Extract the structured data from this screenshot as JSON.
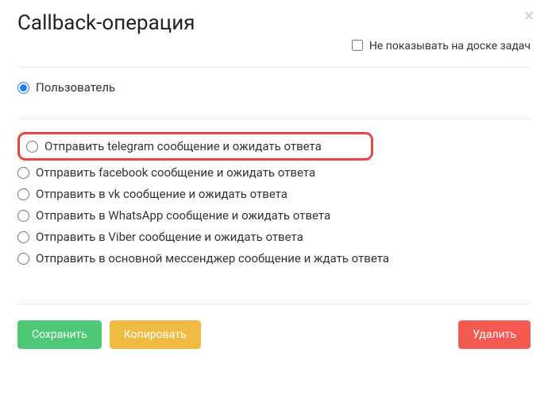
{
  "modal": {
    "title": "Callback-операция",
    "hide_checkbox_label": "Не показывать на доске задач",
    "hide_checked": false,
    "top_group": {
      "options": [
        {
          "label": "Пользователь",
          "checked": true
        }
      ]
    },
    "action_group": {
      "highlighted_index": 0,
      "options": [
        {
          "label": "Отправить telegram сообщение и ожидать ответа",
          "checked": false
        },
        {
          "label": "Отправить facebook сообщение и ожидать ответа",
          "checked": false
        },
        {
          "label": "Отправить в vk сообщение и ожидать ответа",
          "checked": false
        },
        {
          "label": "Отправить в WhatsApp сообщение и ожидать ответа",
          "checked": false
        },
        {
          "label": "Отправить в Viber сообщение и ожидать ответа",
          "checked": false
        },
        {
          "label": "Отправить в основной мессенджер сообщение и ждать ответа",
          "checked": false
        }
      ]
    },
    "buttons": {
      "save": "Сохранить",
      "copy": "Копировать",
      "delete": "Удалить"
    }
  }
}
